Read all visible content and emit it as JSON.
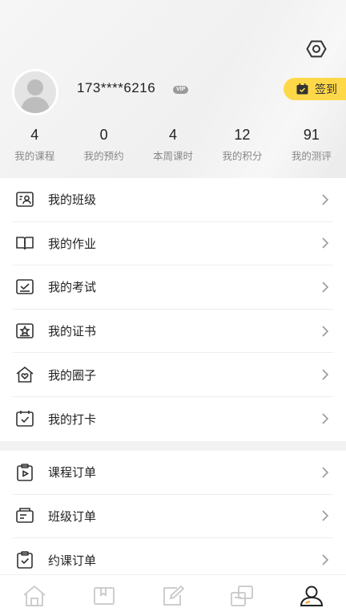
{
  "profile": {
    "phone": "173****6216",
    "vip_badge": "VIP",
    "checkin_label": "签到"
  },
  "stats": [
    {
      "value": "4",
      "label": "我的课程"
    },
    {
      "value": "0",
      "label": "我的预约"
    },
    {
      "value": "4",
      "label": "本周课时"
    },
    {
      "value": "12",
      "label": "我的积分"
    },
    {
      "value": "91",
      "label": "我的测评"
    }
  ],
  "menu_primary": [
    {
      "label": "我的班级",
      "icon": "class-icon"
    },
    {
      "label": "我的作业",
      "icon": "homework-icon"
    },
    {
      "label": "我的考试",
      "icon": "exam-icon"
    },
    {
      "label": "我的证书",
      "icon": "certificate-icon"
    },
    {
      "label": "我的圈子",
      "icon": "circle-icon"
    },
    {
      "label": "我的打卡",
      "icon": "checkin-calendar-icon"
    }
  ],
  "menu_orders": [
    {
      "label": "课程订单",
      "icon": "course-order-icon"
    },
    {
      "label": "班级订单",
      "icon": "class-order-icon"
    },
    {
      "label": "约课订单",
      "icon": "booking-order-icon"
    }
  ],
  "tabbar": [
    {
      "icon": "home-icon"
    },
    {
      "icon": "courses-icon"
    },
    {
      "icon": "edit-icon"
    },
    {
      "icon": "switch-icon"
    },
    {
      "icon": "profile-icon",
      "active": true
    }
  ],
  "colors": {
    "accent": "#ffd84a",
    "text": "#222222",
    "muted": "#888888",
    "icon": "#333333",
    "tab_inactive": "#c8c8c8"
  }
}
